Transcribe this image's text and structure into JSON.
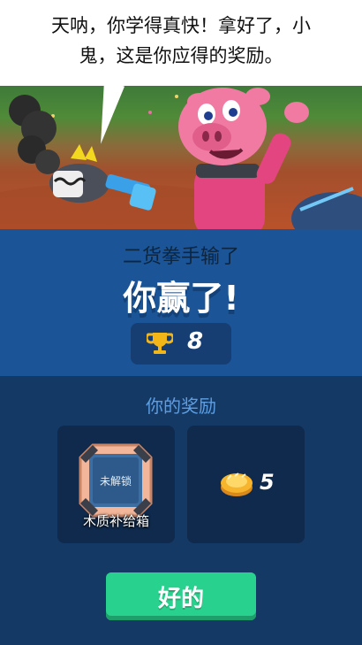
{
  "dialog": {
    "line1": "天呐，你学得真快！拿好了，小",
    "line2": "鬼，这是你应得的奖励。"
  },
  "result": {
    "loser_text": "二货拳手输了",
    "win_text": "你赢了!",
    "trophies": "8"
  },
  "rewards": {
    "title": "你的奖励",
    "chest_status": "未解锁",
    "chest_name": "木质补给箱",
    "coins": "5"
  },
  "button": {
    "ok_label": "好的"
  },
  "icons": [
    "trophy-icon",
    "chest-icon",
    "coin-icon"
  ],
  "colors": {
    "panel_blue": "#1b5597",
    "dark_navy": "#153965",
    "button_green": "#28d28e",
    "title_light_blue": "#5d9ee2"
  }
}
